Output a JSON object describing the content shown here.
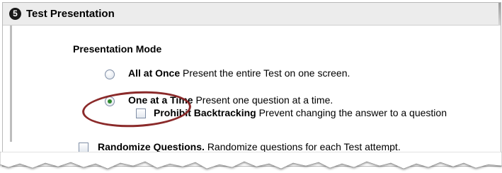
{
  "section": {
    "step_number": "5",
    "title": "Test Presentation"
  },
  "presentation_mode": {
    "heading": "Presentation Mode",
    "options": [
      {
        "label": "All at Once",
        "description": "Present the entire Test on one screen.",
        "selected": false
      },
      {
        "label": "One at a Time",
        "description": "Present one question at a time.",
        "selected": true
      }
    ],
    "prohibit_backtracking": {
      "label": "Prohibit Backtracking",
      "description": "Prevent changing the answer to a question",
      "checked": false
    }
  },
  "randomize_questions": {
    "label": "Randomize Questions.",
    "description": "Randomize questions for each Test attempt.",
    "checked": false
  },
  "annotation": {
    "color": "#8b2a2a"
  }
}
